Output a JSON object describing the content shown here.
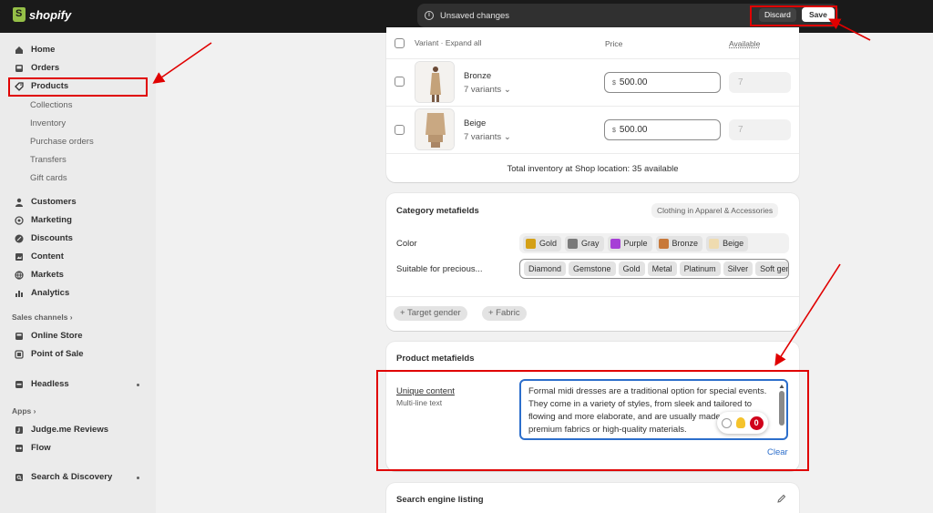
{
  "topbar": {
    "brand": "shopify",
    "unsaved_label": "Unsaved changes",
    "discard_label": "Discard",
    "save_label": "Save"
  },
  "sidebar": {
    "main_items": [
      {
        "label": "Home",
        "icon": "home-icon"
      },
      {
        "label": "Orders",
        "icon": "inbox-icon"
      },
      {
        "label": "Products",
        "icon": "tag-icon"
      }
    ],
    "product_subitems": [
      "Collections",
      "Inventory",
      "Purchase orders",
      "Transfers",
      "Gift cards"
    ],
    "more_items": [
      {
        "label": "Customers",
        "icon": "person-icon"
      },
      {
        "label": "Marketing",
        "icon": "target-icon"
      },
      {
        "label": "Discounts",
        "icon": "discount-icon"
      },
      {
        "label": "Content",
        "icon": "content-icon"
      },
      {
        "label": "Markets",
        "icon": "globe-icon"
      },
      {
        "label": "Analytics",
        "icon": "bar-chart-icon"
      }
    ],
    "sales_channels_label": "Sales channels",
    "sales_channels": [
      {
        "label": "Online Store",
        "icon": "store-icon"
      },
      {
        "label": "Point of Sale",
        "icon": "pos-icon"
      }
    ],
    "headless_label": "Headless",
    "apps_label": "Apps",
    "apps": [
      {
        "label": "Judge.me Reviews",
        "icon": "judgeme-icon"
      },
      {
        "label": "Flow",
        "icon": "flow-icon"
      }
    ],
    "search_discovery_label": "Search & Discovery"
  },
  "variants": {
    "header_variant": "Variant · Expand all",
    "header_price": "Price",
    "header_available": "Available",
    "rows": [
      {
        "name": "Bronze",
        "count": "7 variants",
        "currency": "$",
        "price": "500.00",
        "available": "7"
      },
      {
        "name": "Beige",
        "count": "7 variants",
        "currency": "$",
        "price": "500.00",
        "available": "7"
      }
    ],
    "total_inventory": "Total inventory at Shop location: 35 available"
  },
  "category_metafields": {
    "title": "Category metafields",
    "category_badge": "Clothing in Apparel & Accessories",
    "color_label": "Color",
    "colors": [
      {
        "name": "Gold",
        "hex": "#d4a017"
      },
      {
        "name": "Gray",
        "hex": "#7a7a7a"
      },
      {
        "name": "Purple",
        "hex": "#a640d6"
      },
      {
        "name": "Bronze",
        "hex": "#c8793a"
      },
      {
        "name": "Beige",
        "hex": "#efdbb0"
      }
    ],
    "suitable_label": "Suitable for precious...",
    "suitable_values": [
      "Diamond",
      "Gemstone",
      "Gold",
      "Metal",
      "Platinum",
      "Silver",
      "Soft gem"
    ],
    "add_buttons": [
      "+ Target gender",
      "+ Fabric"
    ]
  },
  "product_metafields": {
    "title": "Product metafields",
    "field_name": "Unique content",
    "field_type": "Multi-line text",
    "field_value": "Formal midi dresses are a traditional option for special events. They come in a variety of styles, from sleek and tailored to flowing and more elaborate, and are usually made from premium fabrics or high-quality materials.",
    "tool_count": "0",
    "clear_label": "Clear"
  },
  "seo": {
    "title": "Search engine listing"
  },
  "colors": {
    "accent_blue": "#2c6ecb",
    "highlight_red": "#e00000",
    "topbar_bg": "#1a1a1a"
  }
}
